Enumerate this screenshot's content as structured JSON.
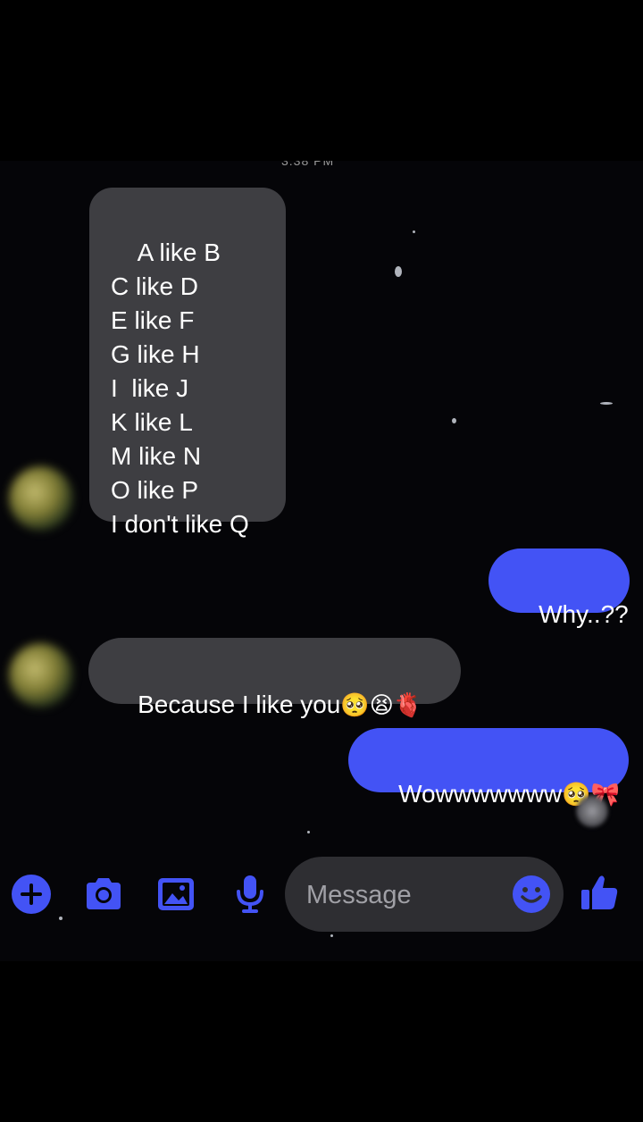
{
  "status": {
    "time_partial": "3:38 PM"
  },
  "conversation": {
    "messages": [
      {
        "direction": "incoming",
        "text": "A like B\nC like D\nE like F\nG like H\nI  like J\nK like L\nM like N\nO like P\nI don't like Q"
      },
      {
        "direction": "outgoing",
        "text": "Why..??"
      },
      {
        "direction": "incoming",
        "text": "Because I like you",
        "emojis": "🥺😫🫀"
      },
      {
        "direction": "outgoing",
        "text": "Wowwwwwww",
        "emojis": "🥺🎀"
      }
    ]
  },
  "composer": {
    "placeholder": "Message",
    "actions": [
      {
        "icon": "plus-circle-icon"
      },
      {
        "icon": "camera-icon"
      },
      {
        "icon": "image-icon"
      },
      {
        "icon": "microphone-icon"
      },
      {
        "icon": "emoji-icon"
      },
      {
        "icon": "thumbs-up-icon"
      }
    ]
  },
  "colors": {
    "accent": "#4353f5",
    "incoming_bubble": "#3e3e42",
    "background": "#050508"
  }
}
